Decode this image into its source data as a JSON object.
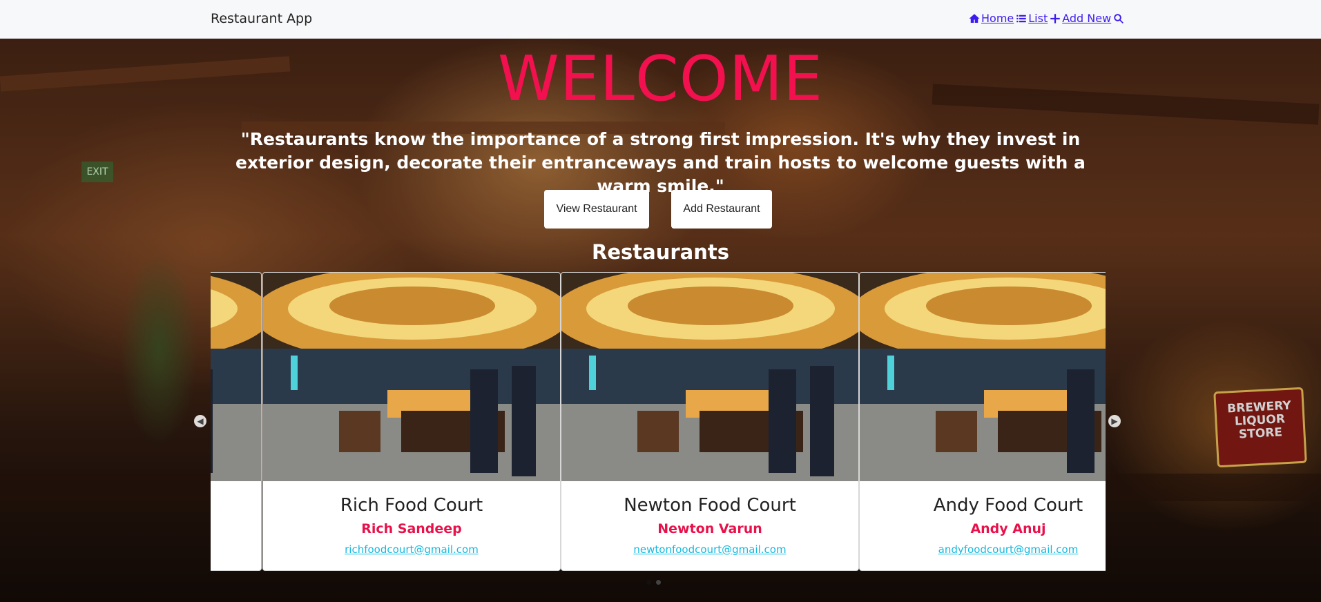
{
  "navbar": {
    "brand": "Restaurant App",
    "links": [
      {
        "label": "Home",
        "icon": "home-icon"
      },
      {
        "label": "List",
        "icon": "list-icon"
      },
      {
        "label": "Add New",
        "icon": "plus-icon"
      },
      {
        "label": "",
        "icon": "search-icon"
      }
    ]
  },
  "hero": {
    "title": "WELCOME",
    "quote": "\"Restaurants know the importance of a strong first impression. It's why they invest in exterior design, decorate their entranceways and train hosts to welcome guests with a warm smile.\"",
    "buttons": {
      "view": "View Restaurant",
      "add": "Add Restaurant"
    },
    "section_title": "Restaurants",
    "sign_text": "BREWERY LIQUOR STORE",
    "exit_text": "EXIT"
  },
  "restaurants": [
    {
      "name": "Rich Food Court",
      "owner": "Rich Sandeep",
      "email": "richfoodcourt@gmail.com"
    },
    {
      "name": "Newton Food Court",
      "owner": "Newton Varun",
      "email": "newtonfoodcourt@gmail.com"
    },
    {
      "name": "Andy Food Court",
      "owner": "Andy Anuj",
      "email": "andyfoodcourt@gmail.com"
    }
  ],
  "colors": {
    "accent": "#f2104f",
    "owner": "#e8114a",
    "email": "#14b9e0",
    "nav_link": "#3b1cf0"
  }
}
